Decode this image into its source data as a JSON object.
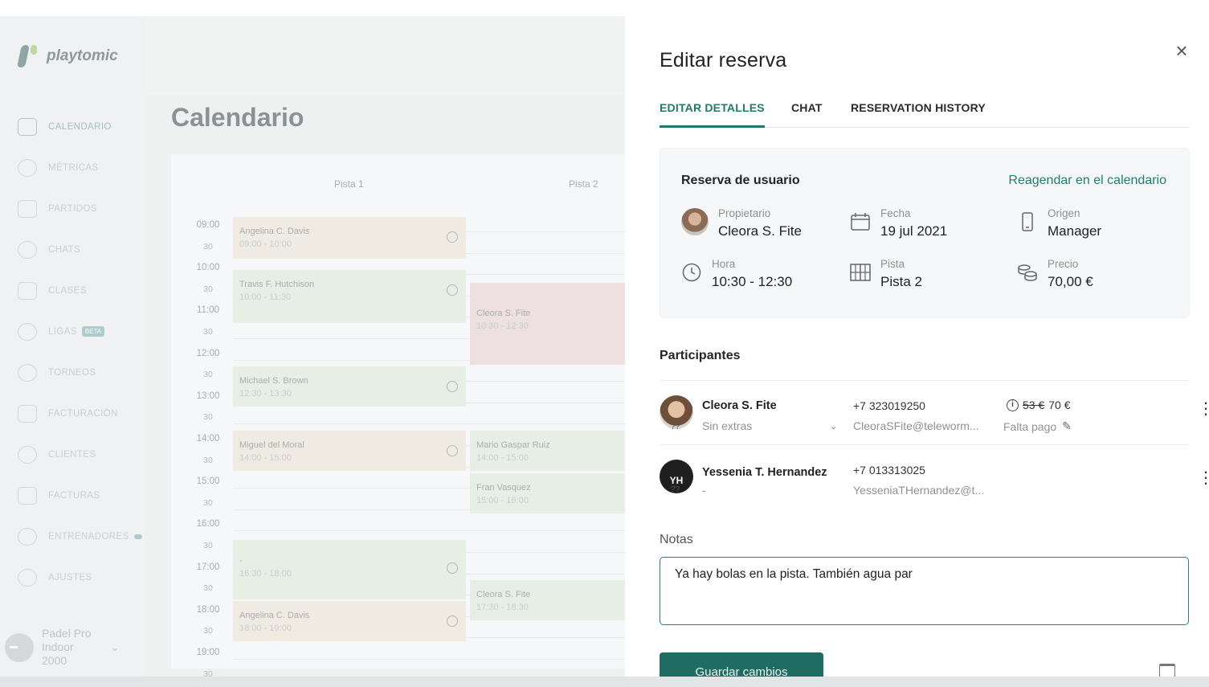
{
  "app": {
    "logo_text": "playtomic",
    "nav": [
      {
        "label": "CALENDARIO",
        "icon": "calendar-icon",
        "active": true
      },
      {
        "label": "MÉTRICAS",
        "icon": "metrics-icon"
      },
      {
        "label": "PARTIDOS",
        "icon": "matches-icon"
      },
      {
        "label": "CHATS",
        "icon": "chat-icon"
      },
      {
        "label": "CLASES",
        "icon": "classes-icon"
      },
      {
        "label": "LIGAS",
        "icon": "trophy-icon",
        "badge": "BETA"
      },
      {
        "label": "TORNEOS",
        "icon": "tournament-icon"
      },
      {
        "label": "FACTURACIÓN",
        "icon": "billing-icon"
      },
      {
        "label": "CLIENTES",
        "icon": "clients-icon"
      },
      {
        "label": "FACTURAS",
        "icon": "invoice-icon"
      },
      {
        "label": "ENTRENADORES",
        "icon": "whistle-icon"
      },
      {
        "label": "AJUSTES",
        "icon": "gear-icon"
      }
    ],
    "venue": "Padel Pro Indoor 2000",
    "page_title": "Calendario",
    "columns": [
      "Pista 1",
      "Pista 2"
    ],
    "times": [
      "09:00",
      "30",
      "10:00",
      "30",
      "11:00",
      "30",
      "12:00",
      "30",
      "13:00",
      "30",
      "14:00",
      "30",
      "15:00",
      "30",
      "16:00",
      "30",
      "17:00",
      "30",
      "18:00",
      "30",
      "19:00",
      "30"
    ],
    "bookings": [
      {
        "name": "Angelina C. Davis",
        "time": "09:00 - 10:00",
        "color": "tan"
      },
      {
        "name": "Travis F. Hutchison",
        "time": "10:00 - 11:30",
        "color": "green"
      },
      {
        "name": "Cleora S. Fite",
        "time": "10:30 - 12:30",
        "color": "pink"
      },
      {
        "name": "Michael S. Brown",
        "time": "12:30 - 13:30",
        "color": "green"
      },
      {
        "name": "Miguel del Moral",
        "time": "14:00 - 15:00",
        "color": "tan"
      },
      {
        "name": "Mario Gaspar Ruiz",
        "time": "14:00 - 15:00",
        "color": "green"
      },
      {
        "name": "Fran Vasquez",
        "time": "15:00 - 16:00",
        "color": "green"
      },
      {
        "name": "-",
        "time": "16:30 - 18:00",
        "color": "green"
      },
      {
        "name": "Cleora S. Fite",
        "time": "17:30 - 18:30",
        "color": "green"
      },
      {
        "name": "Angelina C. Davis",
        "time": "18:00 - 19:00",
        "color": "tan"
      }
    ]
  },
  "drawer": {
    "title": "Editar reserva",
    "tabs": [
      "EDITAR DETALLES",
      "CHAT",
      "RESERVATION HISTORY"
    ],
    "card": {
      "title": "Reserva de usuario",
      "link": "Reagendar en el calendario",
      "fields": {
        "owner": {
          "label": "Propietario",
          "value": "Cleora S. Fite"
        },
        "date": {
          "label": "Fecha",
          "value": "19 jul 2021"
        },
        "origin": {
          "label": "Origen",
          "value": "Manager"
        },
        "time": {
          "label": "Hora",
          "value": "10:30 - 12:30"
        },
        "court": {
          "label": "Pista",
          "value": "Pista 2"
        },
        "price": {
          "label": "Precio",
          "value": "70,00 €"
        }
      }
    },
    "participants_title": "Participantes",
    "participants": [
      {
        "name": "Cleora S. Fite",
        "level": "??",
        "extras": "Sin extras",
        "phone": "+7 323019250",
        "email": "CleoraSFite@teleworm...",
        "old_price": "53 €",
        "price": "70 €",
        "status": "Falta pago"
      },
      {
        "name": "Yessenia T. Hernandez",
        "initials": "YH",
        "level": "??",
        "extras": "-",
        "phone": "+7 013313025",
        "email": "YesseniaTHernandez@t..."
      }
    ],
    "notes_label": "Notas",
    "notes_value": "Ya hay bolas en la pista. También agua par",
    "save_label": "Guardar cambios"
  },
  "colors": {
    "accent": "#1e7a6c",
    "button": "#1f6d62"
  }
}
